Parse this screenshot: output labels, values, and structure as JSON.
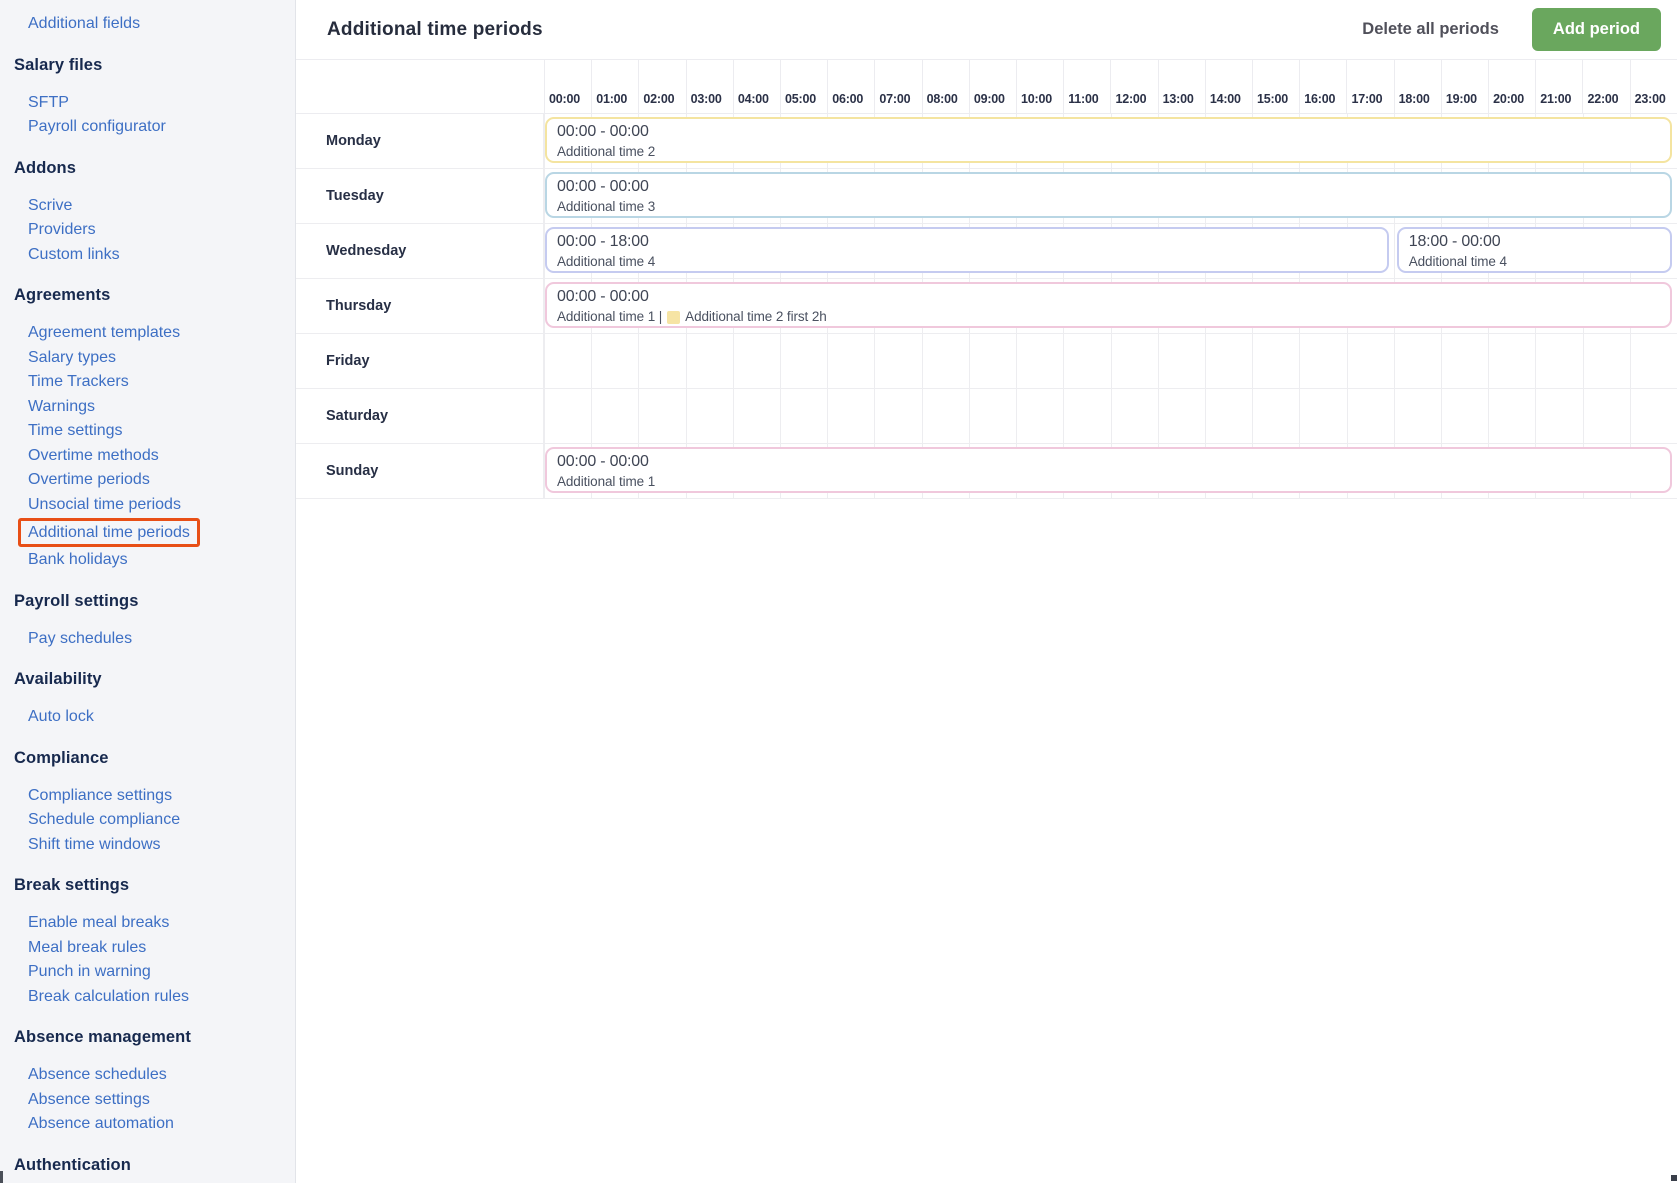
{
  "sidebar": {
    "sections": [
      {
        "heading": null,
        "items": [
          {
            "label": "Additional fields"
          }
        ]
      },
      {
        "heading": "Salary files",
        "items": [
          {
            "label": "SFTP"
          },
          {
            "label": "Payroll configurator"
          }
        ]
      },
      {
        "heading": "Addons",
        "items": [
          {
            "label": "Scrive"
          },
          {
            "label": "Providers"
          },
          {
            "label": "Custom links"
          }
        ]
      },
      {
        "heading": "Agreements",
        "items": [
          {
            "label": "Agreement templates"
          },
          {
            "label": "Salary types"
          },
          {
            "label": "Time Trackers"
          },
          {
            "label": "Warnings"
          },
          {
            "label": "Time settings"
          },
          {
            "label": "Overtime methods"
          },
          {
            "label": "Overtime periods"
          },
          {
            "label": "Unsocial time periods"
          },
          {
            "label": "Additional time periods",
            "highlighted": true
          },
          {
            "label": "Bank holidays"
          }
        ]
      },
      {
        "heading": "Payroll settings",
        "items": [
          {
            "label": "Pay schedules"
          }
        ]
      },
      {
        "heading": "Availability",
        "items": [
          {
            "label": "Auto lock"
          }
        ]
      },
      {
        "heading": "Compliance",
        "items": [
          {
            "label": "Compliance settings"
          },
          {
            "label": "Schedule compliance"
          },
          {
            "label": "Shift time windows"
          }
        ]
      },
      {
        "heading": "Break settings",
        "items": [
          {
            "label": "Enable meal breaks"
          },
          {
            "label": "Meal break rules"
          },
          {
            "label": "Punch in warning"
          },
          {
            "label": "Break calculation rules"
          }
        ]
      },
      {
        "heading": "Absence management",
        "items": [
          {
            "label": "Absence schedules"
          },
          {
            "label": "Absence settings"
          },
          {
            "label": "Absence automation"
          }
        ]
      },
      {
        "heading": "Authentication",
        "items": []
      }
    ]
  },
  "header": {
    "title": "Additional time periods",
    "delete_button": "Delete all periods",
    "add_button": "Add period"
  },
  "schedule": {
    "hours": [
      "00:00",
      "01:00",
      "02:00",
      "03:00",
      "04:00",
      "05:00",
      "06:00",
      "07:00",
      "08:00",
      "09:00",
      "10:00",
      "11:00",
      "12:00",
      "13:00",
      "14:00",
      "15:00",
      "16:00",
      "17:00",
      "18:00",
      "19:00",
      "20:00",
      "21:00",
      "22:00",
      "23:00"
    ],
    "hours_per_day": 24,
    "rows": [
      {
        "day": "Monday",
        "bars": [
          {
            "time": "00:00 - 00:00",
            "start": 0,
            "end": 24,
            "border_color": "#f4e4a0",
            "label_parts": [
              {
                "text": "Additional time 2"
              }
            ]
          }
        ]
      },
      {
        "day": "Tuesday",
        "bars": [
          {
            "time": "00:00 - 00:00",
            "start": 0,
            "end": 24,
            "border_color": "#b9d6e4",
            "label_parts": [
              {
                "text": "Additional time 3"
              }
            ]
          }
        ]
      },
      {
        "day": "Wednesday",
        "bars": [
          {
            "time": "00:00 - 18:00",
            "start": 0,
            "end": 18,
            "border_color": "#c5cbf0",
            "label_parts": [
              {
                "text": "Additional time 4"
              }
            ]
          },
          {
            "time": "18:00 - 00:00",
            "start": 18,
            "end": 24,
            "border_color": "#c5cbf0",
            "label_parts": [
              {
                "text": "Additional time 4"
              }
            ]
          }
        ]
      },
      {
        "day": "Thursday",
        "bars": [
          {
            "time": "00:00 - 00:00",
            "start": 0,
            "end": 24,
            "border_color": "#f0c8dc",
            "label_parts": [
              {
                "text": "Additional time 1 |"
              },
              {
                "chip": "#f6e4a4"
              },
              {
                "text": "Additional time 2 first 2h"
              }
            ]
          }
        ]
      },
      {
        "day": "Friday",
        "bars": []
      },
      {
        "day": "Saturday",
        "bars": []
      },
      {
        "day": "Sunday",
        "bars": [
          {
            "time": "00:00 - 00:00",
            "start": 0,
            "end": 24,
            "border_color": "#f0c8dc",
            "label_parts": [
              {
                "text": "Additional time 1"
              }
            ]
          }
        ]
      }
    ]
  },
  "colors": {
    "accent_green": "#6aa75e",
    "annotation_red": "#e84f16",
    "link_blue": "#3d6fc4",
    "grid_line": "#ededf0"
  }
}
